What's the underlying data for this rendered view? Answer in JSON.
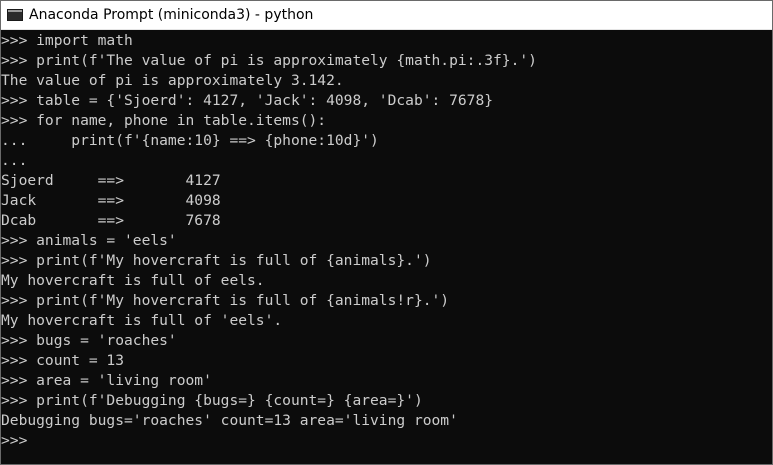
{
  "window": {
    "title": "Anaconda Prompt (miniconda3) - python"
  },
  "console": {
    "lines": [
      ">>> import math",
      ">>> print(f'The value of pi is approximately {math.pi:.3f}.')",
      "The value of pi is approximately 3.142.",
      ">>> table = {'Sjoerd': 4127, 'Jack': 4098, 'Dcab': 7678}",
      ">>> for name, phone in table.items():",
      "...     print(f'{name:10} ==> {phone:10d}')",
      "...",
      "Sjoerd     ==>       4127",
      "Jack       ==>       4098",
      "Dcab       ==>       7678",
      ">>> animals = 'eels'",
      ">>> print(f'My hovercraft is full of {animals}.')",
      "My hovercraft is full of eels.",
      ">>> print(f'My hovercraft is full of {animals!r}.')",
      "My hovercraft is full of 'eels'.",
      ">>> bugs = 'roaches'",
      ">>> count = 13",
      ">>> area = 'living room'",
      ">>> print(f'Debugging {bugs=} {count=} {area=}')",
      "Debugging bugs='roaches' count=13 area='living room'",
      ">>>"
    ]
  },
  "colors": {
    "console_background": "#0c0c0c",
    "console_text": "#cccccc",
    "titlebar_background": "#ffffff"
  }
}
